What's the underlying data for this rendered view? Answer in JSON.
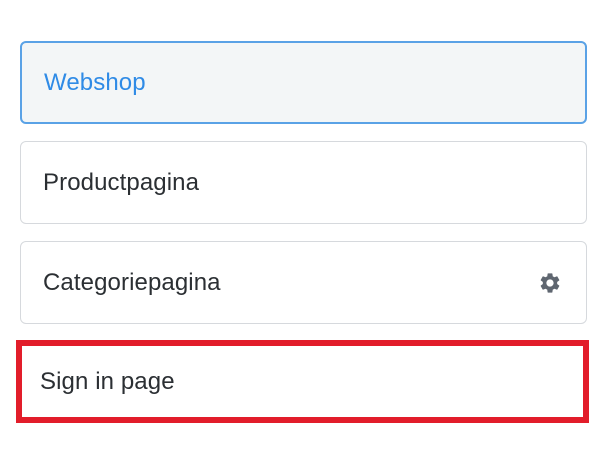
{
  "pages": {
    "items": [
      {
        "label": "Webshop",
        "state": "selected"
      },
      {
        "label": "Productpagina",
        "state": "default"
      },
      {
        "label": "Categoriepagina",
        "state": "default",
        "icon": "gear-icon"
      },
      {
        "label": "Sign in page",
        "state": "highlighted"
      }
    ]
  },
  "colors": {
    "selected_text": "#2f8be6",
    "selected_border": "#5aa2e6",
    "highlight_border": "#e21d2a",
    "icon": "#5f6670"
  }
}
